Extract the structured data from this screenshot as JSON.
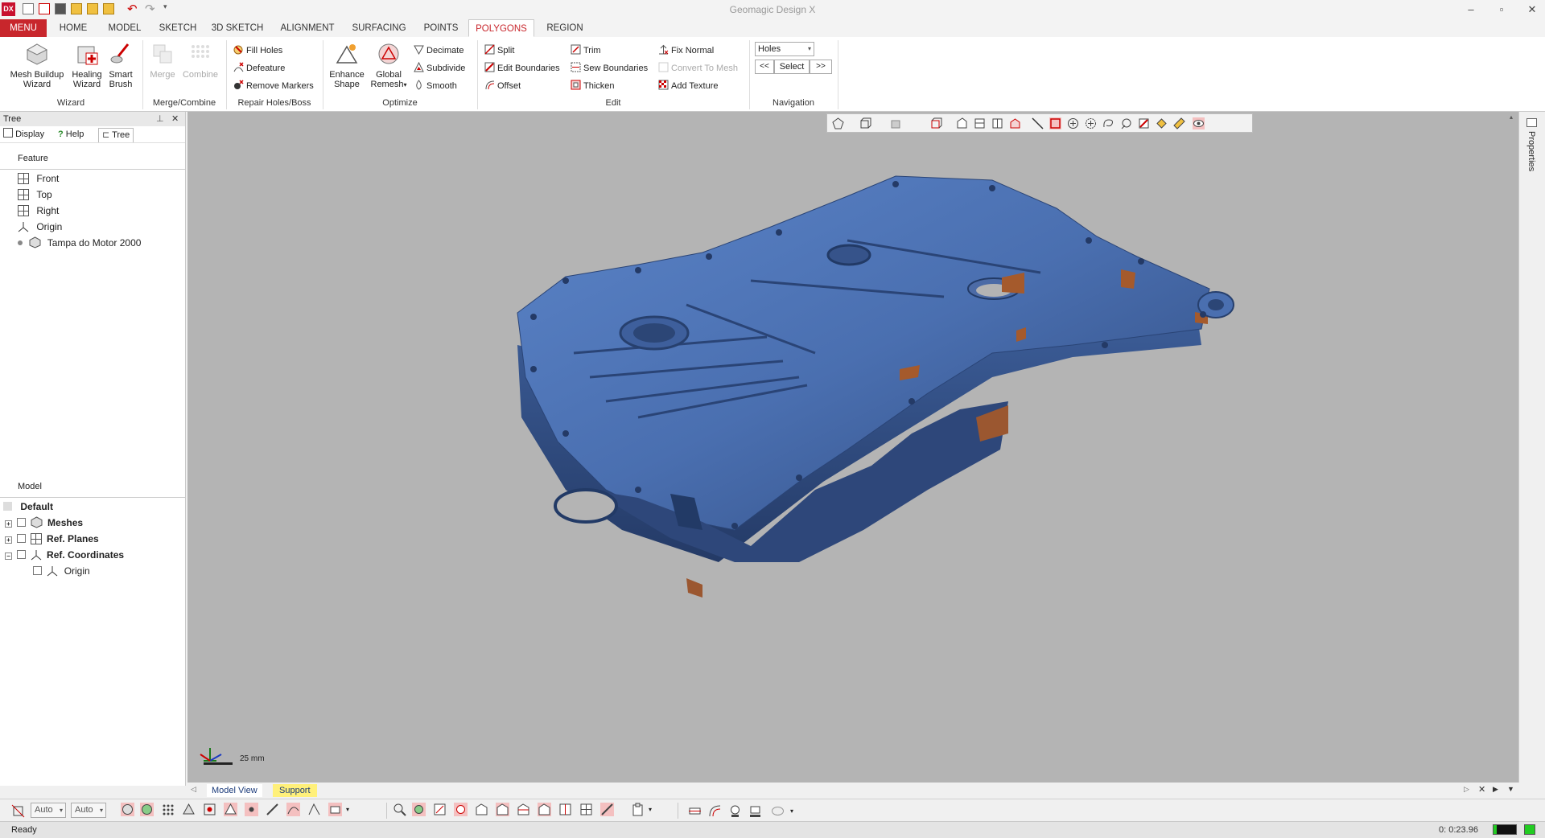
{
  "app": {
    "logo": "DX",
    "title": "Geomagic Design X",
    "window_controls": {
      "minimize": "–",
      "restore": "▫",
      "close": "✕"
    }
  },
  "tabs": [
    "MENU",
    "HOME",
    "MODEL",
    "SKETCH",
    "3D SKETCH",
    "ALIGNMENT",
    "SURFACING",
    "POINTS",
    "POLYGONS",
    "REGION"
  ],
  "active_tab": "POLYGONS",
  "ribbon": {
    "wizard": {
      "label": "Wizard",
      "mesh_buildup": [
        "Mesh Buildup",
        "Wizard"
      ],
      "healing": [
        "Healing",
        "Wizard"
      ],
      "smart_brush": [
        "Smart",
        "Brush"
      ]
    },
    "merge": {
      "label": "Merge/Combine",
      "merge": "Merge",
      "combine": "Combine"
    },
    "repair": {
      "label": "Repair Holes/Boss",
      "fill_holes": "Fill Holes",
      "defeature": "Defeature",
      "remove_markers": "Remove Markers"
    },
    "optimize": {
      "label": "Optimize",
      "enhance": [
        "Enhance",
        "Shape"
      ],
      "global_remesh": [
        "Global",
        "Remesh"
      ],
      "decimate": "Decimate",
      "subdivide": "Subdivide",
      "smooth": "Smooth"
    },
    "edit": {
      "label": "Edit",
      "split": "Split",
      "edit_boundaries": "Edit Boundaries",
      "offset": "Offset",
      "trim": "Trim",
      "sew_boundaries": "Sew Boundaries",
      "thicken": "Thicken",
      "fix_normal": "Fix Normal",
      "convert_to_mesh": "Convert To Mesh",
      "add_texture": "Add Texture"
    },
    "navigation": {
      "label": "Navigation",
      "dropdown_value": "Holes",
      "prev": "<<",
      "select": "Select",
      "next": ">>"
    }
  },
  "panel": {
    "title": "Tree",
    "pin": "⊥",
    "close": "✕",
    "tabs": {
      "display": "Display",
      "help": "Help",
      "tree": "Tree"
    },
    "feature_header": "Feature",
    "features": [
      "Front",
      "Top",
      "Right",
      "Origin",
      "Tampa do Motor 2000"
    ],
    "model_header": "Model",
    "model": {
      "default": "Default",
      "meshes": "Meshes",
      "ref_planes": "Ref. Planes",
      "ref_coordinates": "Ref. Coordinates",
      "origin": "Origin"
    }
  },
  "viewport": {
    "background": "#b4b4b4",
    "mesh_color": "#4a6fb0",
    "scale_label": "25 mm"
  },
  "right_strip": {
    "label": "Properties"
  },
  "view_tabs": {
    "model_view": "Model View",
    "support": "Support"
  },
  "bottom_bar": {
    "select1": "Auto",
    "select2": "Auto"
  },
  "status": {
    "text": "Ready",
    "timer": "0: 0:23.96"
  }
}
